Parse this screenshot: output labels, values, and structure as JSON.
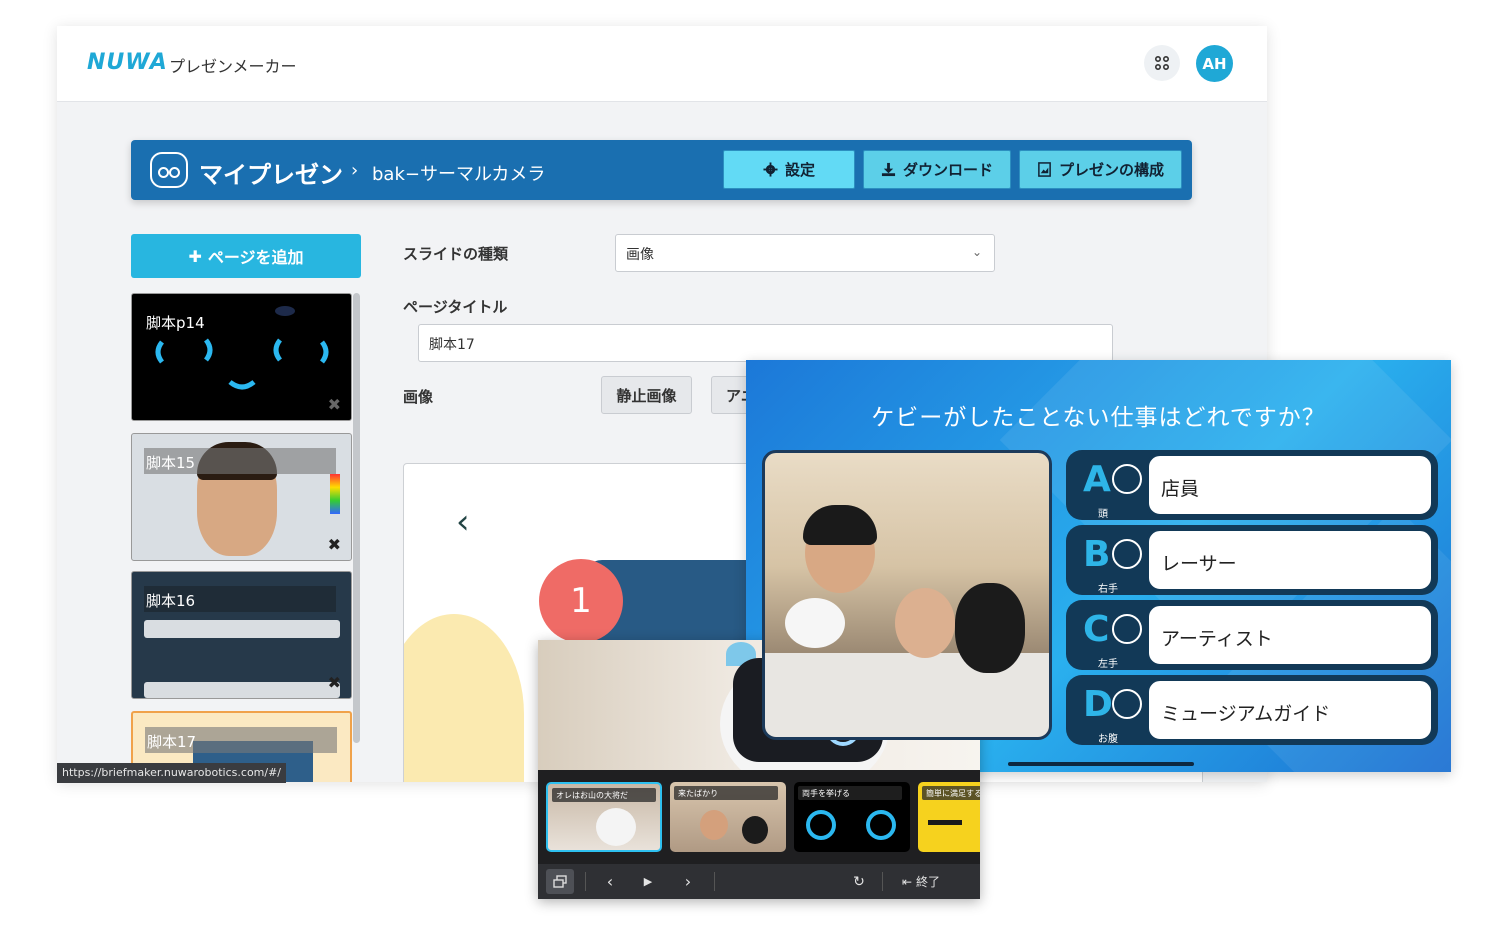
{
  "app": {
    "logo": "NUWA",
    "name": "プレゼンメーカー",
    "avatar_initials": "AH"
  },
  "header": {
    "title": "マイプレゼン",
    "separator": "›",
    "subtitle": "bak−サーマルカメラ",
    "buttons": {
      "settings": "設定",
      "download": "ダウンロード",
      "structure": "プレゼンの構成"
    }
  },
  "sidebar": {
    "add_page_label": "ページを追加",
    "thumbnails": [
      {
        "label": "脚本p14"
      },
      {
        "label": "脚本15"
      },
      {
        "label": "脚本16"
      },
      {
        "label": "脚本17"
      }
    ],
    "delete_symbol": "✖"
  },
  "form": {
    "slide_type_label": "スライドの種類",
    "slide_type_value": "画像",
    "page_title_label": "ページタイトル",
    "page_title_value": "脚本17",
    "image_label": "画像",
    "image_buttons": [
      "静止画像",
      "アニ"
    ]
  },
  "preview": {
    "back_glyph": "‹",
    "number": "1"
  },
  "status_url": "https://briefmaker.nuwarobotics.com/#/",
  "quiz": {
    "question": "ケビーがしたことない仕事はどれですか？",
    "answers": [
      {
        "letter": "A",
        "part": "頭",
        "text": "店員"
      },
      {
        "letter": "B",
        "part": "右手",
        "text": "レーサー"
      },
      {
        "letter": "C",
        "part": "左手",
        "text": "アーティスト"
      },
      {
        "letter": "D",
        "part": "お腹",
        "text": "ミュージアムガイド"
      }
    ]
  },
  "player": {
    "slides": [
      {
        "caption": "オレはお山の大将だ"
      },
      {
        "caption": "来たばかり"
      },
      {
        "caption": "両手を挙げる"
      },
      {
        "caption": "簡単に満足する"
      }
    ],
    "controls": {
      "prev": "‹",
      "play": "▶",
      "next": "›",
      "reload": "↻",
      "exit": "終了"
    }
  },
  "colors": {
    "accent": "#1fa8d6",
    "header_bg": "#1a6fb0",
    "quiz_bg": "#1c78d8",
    "answer_bg": "#123957"
  }
}
